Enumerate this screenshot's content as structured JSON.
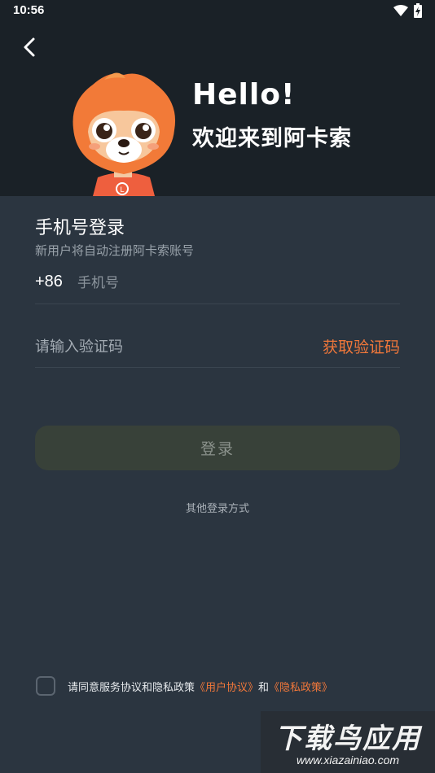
{
  "status_bar": {
    "time": "10:56",
    "icons": [
      "wifi-icon",
      "battery-icon"
    ]
  },
  "header": {
    "back_icon": "chevron-left-icon",
    "mascot_badge": "L",
    "hello": "Hello!",
    "welcome": "欢迎来到阿卡索"
  },
  "form": {
    "title": "手机号登录",
    "hint": "新用户将自动注册阿卡索账号",
    "country_code": "+86",
    "phone_placeholder": "手机号",
    "code_placeholder": "请输入验证码",
    "get_code_label": "获取验证码",
    "login_label": "登录",
    "other_login": "其他登录方式"
  },
  "agreement": {
    "text": "请同意服务协议和隐私政策",
    "user_agreement": "《用户协议》",
    "and": "和",
    "privacy_policy": "《隐私政策》",
    "checked": false
  },
  "watermark": {
    "title": "下载鸟应用",
    "url": "www.xiazainiao.com"
  },
  "colors": {
    "accent": "#f0773a",
    "background": "#2b3540",
    "header_bg": "#1a2127",
    "button_bg": "#384139"
  }
}
